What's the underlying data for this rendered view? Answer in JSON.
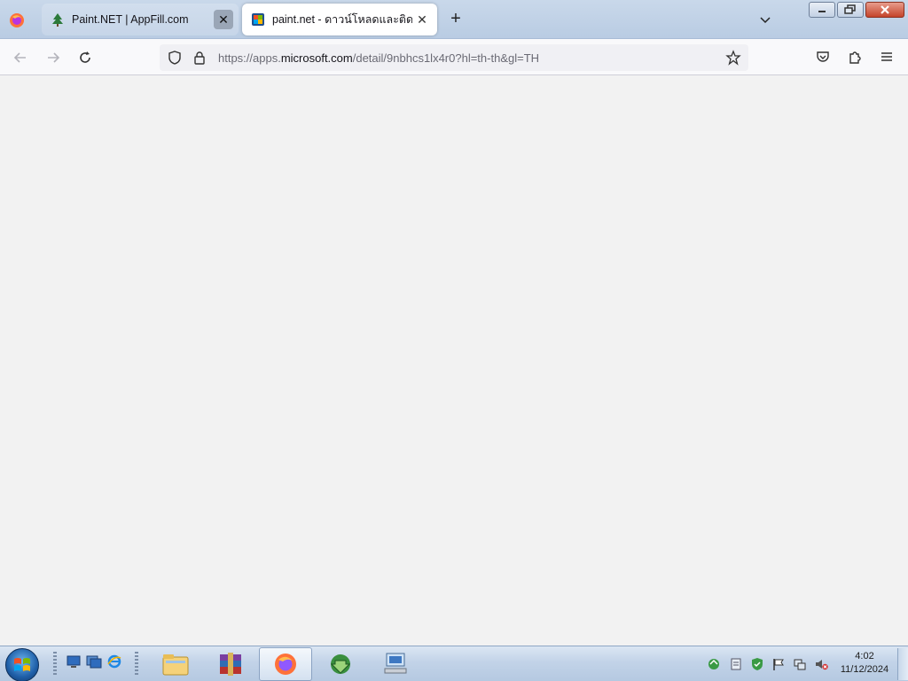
{
  "browser": {
    "tabs": [
      {
        "title": "Paint.NET | AppFill.com",
        "active": false,
        "favicon": "tree-icon"
      },
      {
        "title": "paint.net - ดาวน์โหลดและติดตั้ง",
        "active": true,
        "favicon": "paintnet-icon"
      }
    ],
    "new_tab_symbol": "+",
    "close_symbol": "✕",
    "url": {
      "prefix": "https://apps.",
      "domain": "microsoft.com",
      "path": "/detail/9nbhcs1lx4r0?hl=th-th&gl=TH"
    }
  },
  "taskbar": {
    "apps": [
      "file-explorer-icon",
      "winrar-icon",
      "firefox-icon",
      "idm-icon",
      "network-computer-icon"
    ],
    "active_app": "firefox-icon",
    "tray_icons": [
      "sync-icon",
      "document-icon",
      "security-icon",
      "flag-icon",
      "network-icon",
      "volume-muted-icon"
    ],
    "clock": {
      "time": "4:02",
      "date": "11/12/2024"
    }
  },
  "colors": {
    "tabstrip": "#c9d8ea",
    "content_bg": "#f2f2f2",
    "taskbar": "#c2d3e8"
  }
}
